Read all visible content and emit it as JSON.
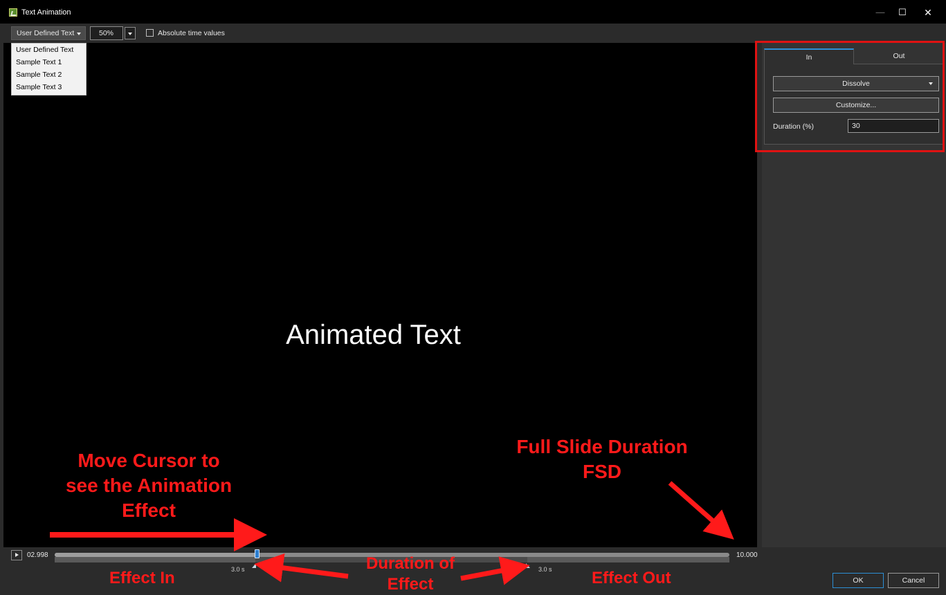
{
  "window": {
    "title": "Text Animation",
    "controls": {
      "minimize": "—",
      "maximize": "☐",
      "close": "✕"
    }
  },
  "toolbar": {
    "preset_selected": "User Defined Text",
    "zoom_value": "50%",
    "absolute_time_label": "Absolute time values",
    "absolute_time_checked": false
  },
  "preset_dropdown": {
    "options": [
      "User Defined Text",
      "Sample Text 1",
      "Sample Text 2",
      "Sample Text 3"
    ]
  },
  "preview": {
    "text": "Animated Text"
  },
  "panel": {
    "tabs": [
      {
        "label": "In",
        "active": true
      },
      {
        "label": "Out",
        "active": false
      }
    ],
    "effect": "Dissolve",
    "customize_label": "Customize...",
    "duration_label": "Duration (%)",
    "duration_value": "30"
  },
  "timeline": {
    "current_time": "02.998",
    "total_time": "10.000",
    "effect_in_duration": "3.0 s",
    "effect_out_duration": "3.0 s",
    "cursor_seconds": 2.998,
    "total_seconds": 10.0
  },
  "buttons": {
    "ok": "OK",
    "cancel": "Cancel"
  },
  "annotations": {
    "move_cursor": [
      "Move Cursor to",
      "see the Animation",
      "Effect"
    ],
    "fsd": [
      "Full Slide Duration",
      "FSD"
    ],
    "effect_in": "Effect In",
    "duration_of_effect": [
      "Duration of",
      "Effect"
    ],
    "effect_out": "Effect Out"
  },
  "colors": {
    "annotation_red": "#ff1a1a",
    "accent_blue": "#2d8fd5",
    "preview_bg": "#000000",
    "panel_bg": "#333333"
  }
}
